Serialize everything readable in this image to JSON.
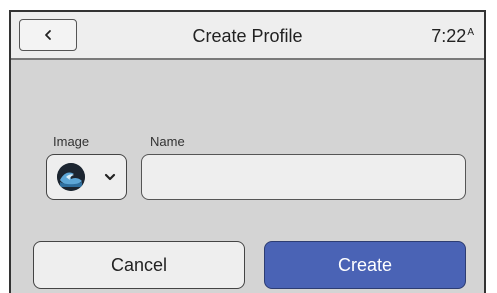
{
  "header": {
    "title": "Create Profile",
    "time": "7:22",
    "time_suffix": "A",
    "back_icon": "chevron-left-icon"
  },
  "form": {
    "image_label": "Image",
    "name_label": "Name",
    "name_value": "",
    "avatar_icon": "wave-avatar-icon",
    "dropdown_icon": "chevron-down-icon"
  },
  "actions": {
    "cancel_label": "Cancel",
    "create_label": "Create"
  },
  "colors": {
    "background": "#d4d4d4",
    "header": "#eeeeee",
    "primary_button": "#4a63b5"
  }
}
